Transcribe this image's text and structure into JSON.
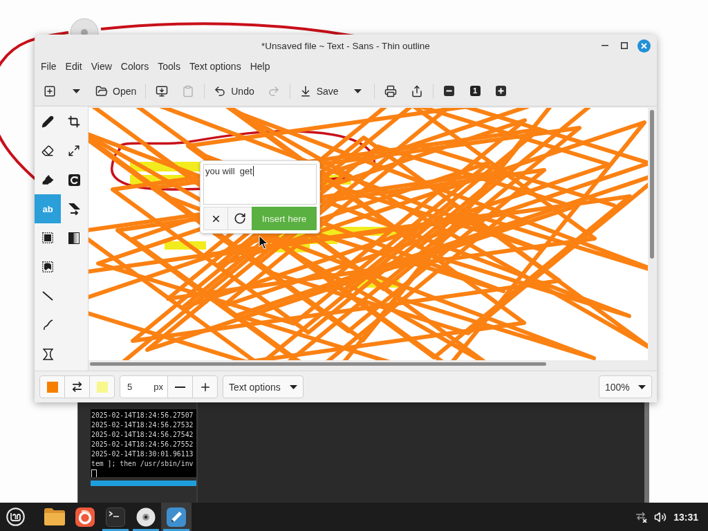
{
  "window": {
    "title": "*Unsaved file ~ Text - Sans - Thin outline"
  },
  "menu": [
    "File",
    "Edit",
    "View",
    "Colors",
    "Tools",
    "Text options",
    "Help"
  ],
  "toolbar": {
    "groups": [
      [
        {
          "kind": "new",
          "disabled": false
        },
        {
          "kind": "menu",
          "disabled": false
        },
        {
          "kind": "open",
          "label": "Open",
          "disabled": false
        }
      ],
      [
        {
          "kind": "import",
          "disabled": false
        },
        {
          "kind": "paste",
          "disabled": true
        }
      ],
      [
        {
          "kind": "undo",
          "label": "Undo",
          "disabled": false
        },
        {
          "kind": "redo",
          "disabled": true
        }
      ],
      [
        {
          "kind": "save",
          "label": "Save",
          "disabled": false
        },
        {
          "kind": "menu",
          "disabled": false
        }
      ],
      [
        {
          "kind": "print",
          "disabled": false
        },
        {
          "kind": "export",
          "disabled": false
        }
      ],
      [
        {
          "kind": "zoom-out",
          "disabled": false
        },
        {
          "kind": "zoom-reset",
          "label": "1",
          "disabled": false
        },
        {
          "kind": "zoom-in",
          "disabled": false
        }
      ]
    ]
  },
  "tools": [
    {
      "kind": "pencil",
      "selected": false
    },
    {
      "kind": "eraser",
      "selected": false
    },
    {
      "kind": "highlighter",
      "selected": false
    },
    {
      "kind": "text",
      "label": "ab",
      "selected": true
    },
    {
      "kind": "rect-select",
      "selected": false
    },
    {
      "kind": "free-select",
      "selected": false
    },
    {
      "kind": "line",
      "selected": false
    },
    {
      "kind": "curve",
      "selected": false
    },
    {
      "kind": "shape",
      "selected": false
    }
  ],
  "canvas_tools": [
    {
      "kind": "crop",
      "selected": false
    },
    {
      "kind": "scale",
      "selected": false
    },
    {
      "kind": "rotate",
      "selected": false
    },
    {
      "kind": "skew",
      "selected": false
    },
    {
      "kind": "filters",
      "selected": false
    }
  ],
  "text_popover": {
    "value": "you will  get",
    "insert_label": "Insert here"
  },
  "options_bar": {
    "colors": [
      {
        "color": "#f77f00"
      },
      {
        "color": "#f8f88c"
      }
    ],
    "size": {
      "value": "5",
      "unit": "px"
    },
    "options_label": "Text options",
    "zoom": "100%"
  },
  "terminal": {
    "lines": [
      "2025-02-14T18:24:56.27507",
      "2025-02-14T18:24:56.27532",
      "2025-02-14T18:24:56.27542",
      "2025-02-14T18:24:56.27552",
      "2025-02-14T18:30:01.96113",
      "tem ]; then /usr/sbin/inv"
    ]
  },
  "taskbar": {
    "apps": [
      {
        "kind": "files",
        "selected": false,
        "running": false
      },
      {
        "kind": "browser",
        "selected": false,
        "running": false
      },
      {
        "kind": "terminal",
        "selected": false,
        "running": true
      },
      {
        "kind": "disc",
        "selected": false,
        "running": true
      },
      {
        "kind": "drawing",
        "selected": true,
        "running": true
      }
    ],
    "clock": "13:31"
  }
}
